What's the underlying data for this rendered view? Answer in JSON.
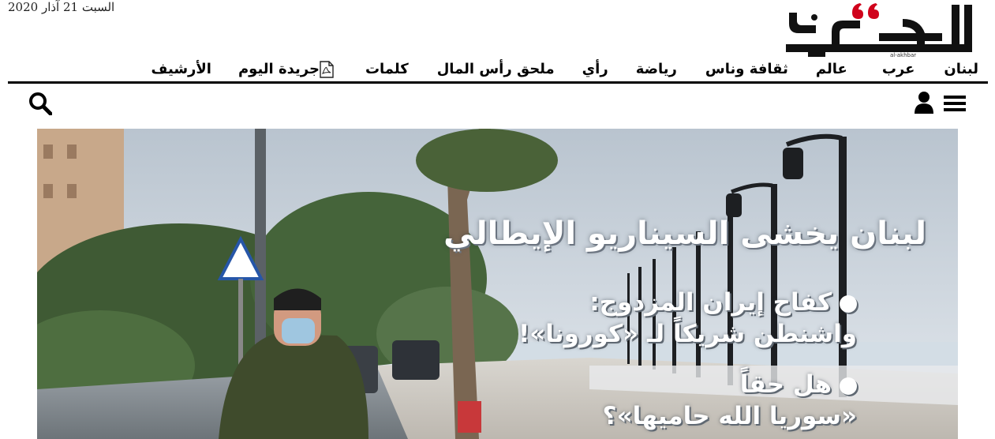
{
  "header": {
    "date": "السبت 21 آذار 2020",
    "logo_text": "الأخبار",
    "logo_subtext": "al-akhbar"
  },
  "nav": {
    "items": [
      {
        "label": "لبنان"
      },
      {
        "label": "عرب"
      },
      {
        "label": "عالم"
      },
      {
        "label": "ثقافة وناس"
      },
      {
        "label": "رياضة"
      },
      {
        "label": "رأي"
      },
      {
        "label": "ملحق رأس المال"
      },
      {
        "label": "كلمات"
      },
      {
        "label": "جريدة اليوم",
        "icon": "pdf-icon"
      },
      {
        "label": "الأرشيف"
      }
    ]
  },
  "toolbar": {
    "icons": [
      "menu-icon",
      "user-icon",
      "search-icon"
    ]
  },
  "hero": {
    "headline": "لبنان يخشى السيناريو الإيطالي",
    "bullet1_line1": "كفاح إيران المزدوج:",
    "bullet1_line2": "واشنطن شريكاً لـ «كورونا»!",
    "bullet2_line1": "هل حقاً",
    "bullet2_line2": "«سوريا الله حاميها»؟"
  },
  "colors": {
    "logo_black": "#111111",
    "logo_red": "#d0021b",
    "nav_border": "#000000",
    "sky": "#c9d3dc",
    "sea": "#d8e2ea"
  }
}
